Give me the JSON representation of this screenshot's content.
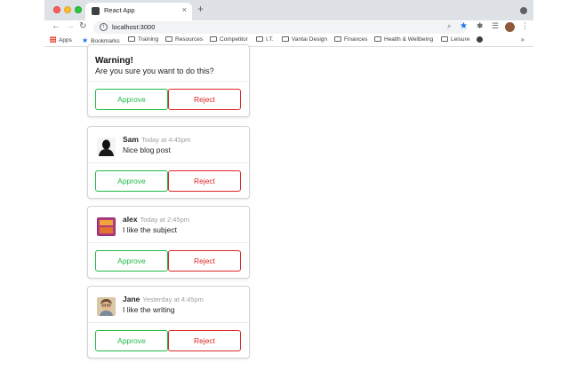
{
  "browser": {
    "tab_title": "React App",
    "tab_close": "×",
    "new_tab": "+",
    "url": "localhost:3000",
    "nav": {
      "back": "←",
      "forward": "→",
      "reload": "↻"
    },
    "bookmarks": [
      "Apps",
      "Bookmarks",
      "Training",
      "Resources",
      "Competitor",
      "I.T.",
      "Vantai Design",
      "Finances",
      "Health & Wellbeing",
      "Leisure"
    ],
    "more_bookmarks": "»",
    "accent": "#1a73e8"
  },
  "warning_card": {
    "title": "Warning!",
    "text": "Are you sure you want to do this?",
    "approve_label": "Approve",
    "reject_label": "Reject"
  },
  "comments": [
    {
      "author": "Sam",
      "date": "Today at 4:45pm",
      "text": "Nice blog post",
      "avatar": "silhouette-avatar",
      "approve_label": "Approve",
      "reject_label": "Reject"
    },
    {
      "author": "alex",
      "date": "Today at 2:45pm",
      "text": "I like the subject",
      "avatar": "ntf-blog-avatar",
      "approve_label": "Approve",
      "reject_label": "Reject"
    },
    {
      "author": "Jane",
      "date": "Yesterday at 4:45pm",
      "text": "I like the writing",
      "avatar": "portrait-avatar",
      "approve_label": "Approve",
      "reject_label": "Reject"
    }
  ],
  "colors": {
    "approve": "#21ba45",
    "reject": "#db2828"
  }
}
